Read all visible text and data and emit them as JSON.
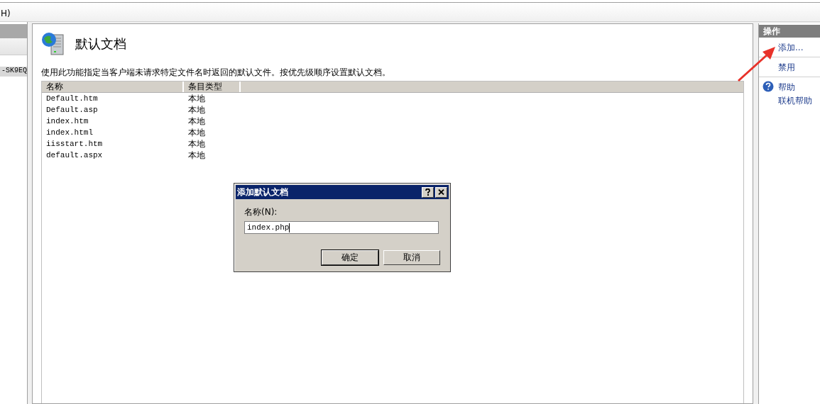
{
  "menu_bar": {
    "items": [
      "H)"
    ]
  },
  "left_pane": {
    "items": [
      {
        "label": "-SK9EQ",
        "selected": true
      }
    ]
  },
  "feature": {
    "title": "默认文档",
    "description": "使用此功能指定当客户端未请求特定文件名时返回的默认文件。按优先级顺序设置默认文档。"
  },
  "table": {
    "columns": [
      "名称",
      "条目类型"
    ],
    "rows": [
      [
        "Default.htm",
        "本地"
      ],
      [
        "Default.asp",
        "本地"
      ],
      [
        "index.htm",
        "本地"
      ],
      [
        "index.html",
        "本地"
      ],
      [
        "iisstart.htm",
        "本地"
      ],
      [
        "default.aspx",
        "本地"
      ]
    ]
  },
  "actions": {
    "title": "操作",
    "groups": [
      [
        {
          "kind": "link",
          "label": "添加..."
        }
      ],
      [
        {
          "kind": "link",
          "label": "禁用"
        }
      ],
      [
        {
          "kind": "help",
          "label": "帮助"
        },
        {
          "kind": "link",
          "label": "联机帮助"
        }
      ]
    ]
  },
  "dialog": {
    "title": "添加默认文档",
    "field_label": "名称(N):",
    "value": "index.php",
    "buttons": [
      {
        "label": "确定",
        "default": true
      },
      {
        "label": "取消",
        "default": false
      }
    ]
  }
}
